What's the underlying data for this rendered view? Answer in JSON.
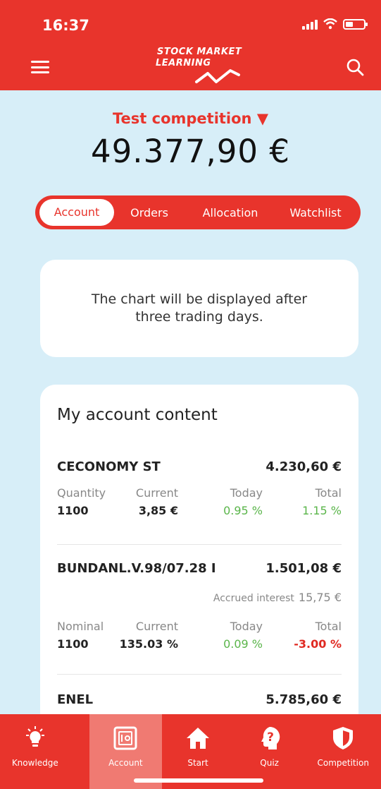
{
  "status_bar": {
    "time": "16:37"
  },
  "header": {
    "logo_line1": "STOCK MARKET",
    "logo_line2": "LEARNING"
  },
  "summary": {
    "competition": "Test competition ▼",
    "balance": "49.377,90 €"
  },
  "tabs": [
    {
      "label": "Account",
      "active": true
    },
    {
      "label": "Orders",
      "active": false
    },
    {
      "label": "Allocation",
      "active": false
    },
    {
      "label": "Watchlist",
      "active": false
    }
  ],
  "chart_card": {
    "message": "The chart will be displayed after three trading days."
  },
  "account": {
    "title": "My account content",
    "holdings": [
      {
        "name": "CECONOMY ST",
        "value": "4.230,60 €",
        "labels": [
          "Quantity",
          "Current",
          "Today",
          "Total"
        ],
        "values": [
          "1100",
          "3,85 €",
          "0.95 %",
          "1.15 %"
        ]
      },
      {
        "name": "BUNDANL.V.98/07.28 I",
        "value": "1.501,08 €",
        "accrued_label": "Accrued interest",
        "accrued_value": "15,75 €",
        "labels": [
          "Nominal",
          "Current",
          "Today",
          "Total"
        ],
        "values": [
          "1100",
          "135.03 %",
          "0.09 %",
          "-3.00 %"
        ]
      },
      {
        "name": "ENEL",
        "value": "5.785,60 €"
      }
    ]
  },
  "bottom_nav": [
    {
      "label": "Knowledge",
      "icon": "lightbulb-icon",
      "active": false
    },
    {
      "label": "Account",
      "icon": "safe-icon",
      "active": true
    },
    {
      "label": "Start",
      "icon": "home-icon",
      "active": false
    },
    {
      "label": "Quiz",
      "icon": "question-head-icon",
      "active": false
    },
    {
      "label": "Competition",
      "icon": "shield-icon",
      "active": false
    }
  ],
  "colors": {
    "brand_red": "#e8342c",
    "background": "#d7eef8",
    "positive": "#5ab54a",
    "negative": "#e02a22"
  }
}
